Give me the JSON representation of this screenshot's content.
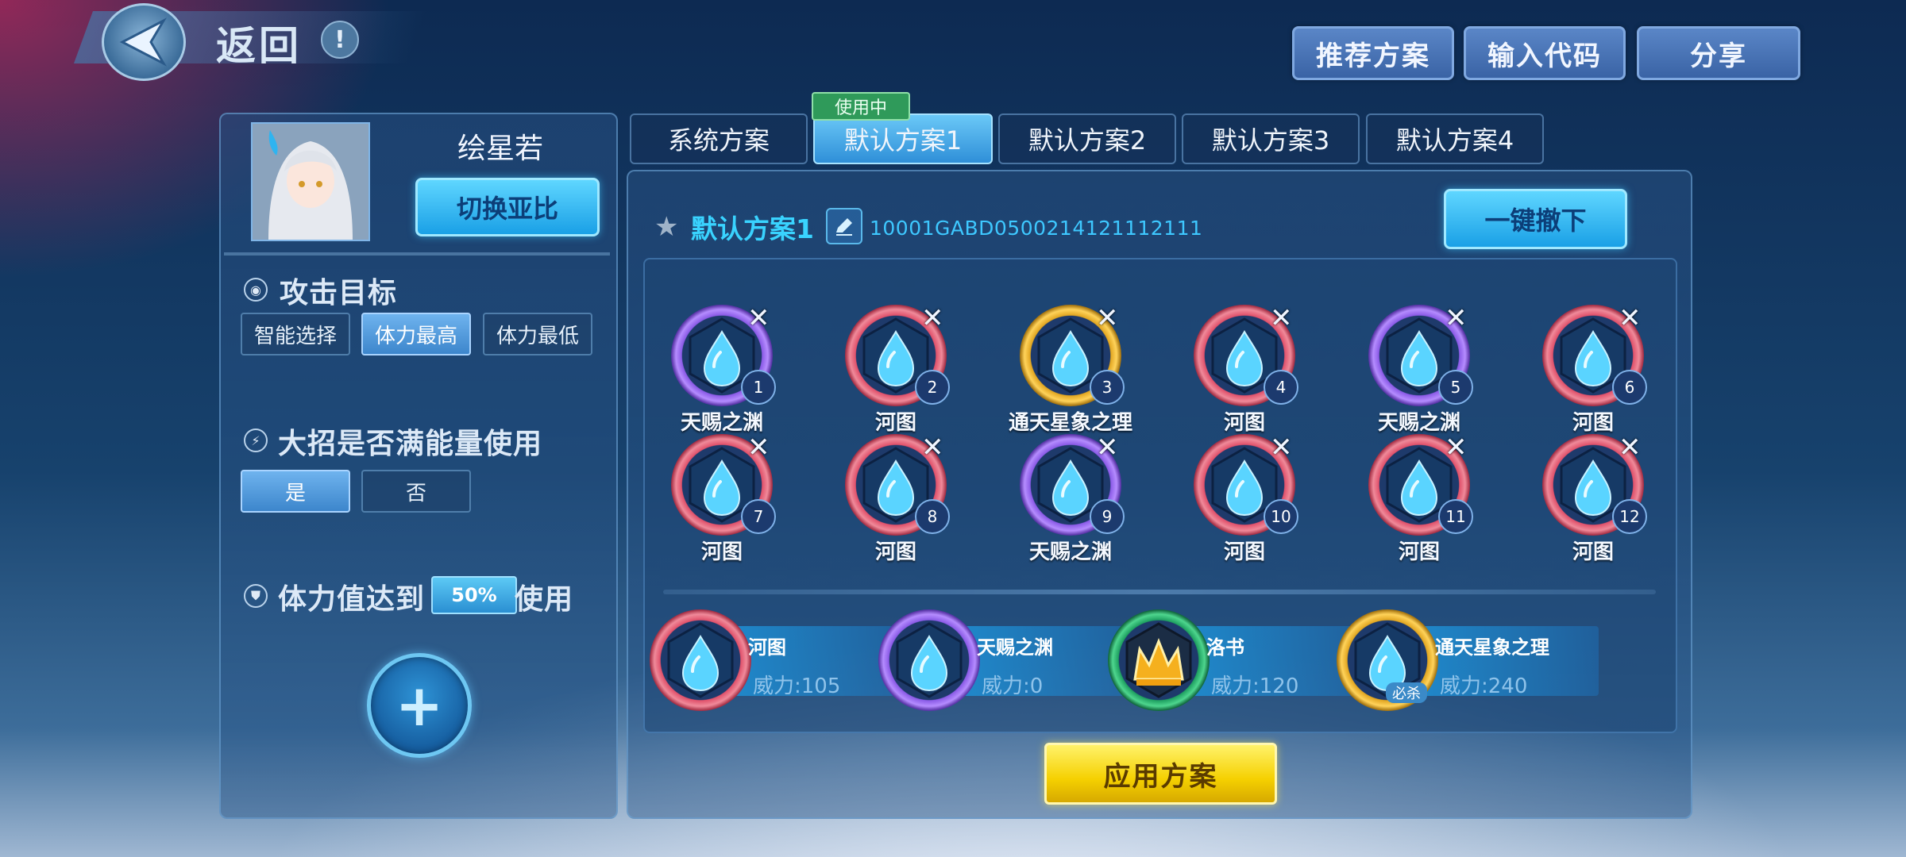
{
  "header": {
    "back_label": "返回",
    "info_icon": "!",
    "recommend_button": "推荐方案",
    "input_code_button": "输入代码",
    "share_button": "分享"
  },
  "character": {
    "name": "绘星若",
    "switch_button": "切换亚比"
  },
  "attack_target": {
    "title": "攻击目标",
    "options": [
      "智能选择",
      "体力最高",
      "体力最低"
    ],
    "selected": "体力最高"
  },
  "ultimate": {
    "title": "大招是否满能量使用",
    "options": [
      "是",
      "否"
    ],
    "selected": "是"
  },
  "hp_threshold": {
    "prefix": "体力值达到",
    "value": "50%",
    "suffix": "使用"
  },
  "add_button": "+",
  "tabs": {
    "items": [
      "系统方案",
      "默认方案1",
      "默认方案2",
      "默认方案3",
      "默认方案4"
    ],
    "active": "默认方案1",
    "in_use_badge": "使用中"
  },
  "scheme": {
    "name": "默认方案1",
    "code": "10001GABD0500214121112111",
    "remove_all_button": "一键撤下"
  },
  "slots": [
    {
      "num": "1",
      "label": "天赐之渊",
      "ring": "purple"
    },
    {
      "num": "2",
      "label": "河图",
      "ring": "pink"
    },
    {
      "num": "3",
      "label": "通天星象之理",
      "ring": "gold"
    },
    {
      "num": "4",
      "label": "河图",
      "ring": "pink"
    },
    {
      "num": "5",
      "label": "天赐之渊",
      "ring": "purple"
    },
    {
      "num": "6",
      "label": "河图",
      "ring": "pink"
    },
    {
      "num": "7",
      "label": "河图",
      "ring": "pink"
    },
    {
      "num": "8",
      "label": "河图",
      "ring": "pink"
    },
    {
      "num": "9",
      "label": "天赐之渊",
      "ring": "purple"
    },
    {
      "num": "10",
      "label": "河图",
      "ring": "pink"
    },
    {
      "num": "11",
      "label": "河图",
      "ring": "pink"
    },
    {
      "num": "12",
      "label": "河图",
      "ring": "pink"
    }
  ],
  "available_skills": [
    {
      "name": "河图",
      "power": "威力:105",
      "ring": "pink",
      "icon": "water-drop-icon"
    },
    {
      "name": "天赐之渊",
      "power": "威力:0",
      "ring": "purple",
      "icon": "water-drop-icon"
    },
    {
      "name": "洛书",
      "power": "威力:120",
      "ring": "green",
      "icon": "crown-icon"
    },
    {
      "name": "通天星象之理",
      "power": "威力:240",
      "ring": "gold",
      "icon": "water-drop-icon",
      "badge": "必杀"
    }
  ],
  "apply_button": "应用方案",
  "colors": {
    "accent_cyan": "#39d3ff",
    "apply_yellow": "#f5d000",
    "in_use_green": "#2f9a5a"
  }
}
